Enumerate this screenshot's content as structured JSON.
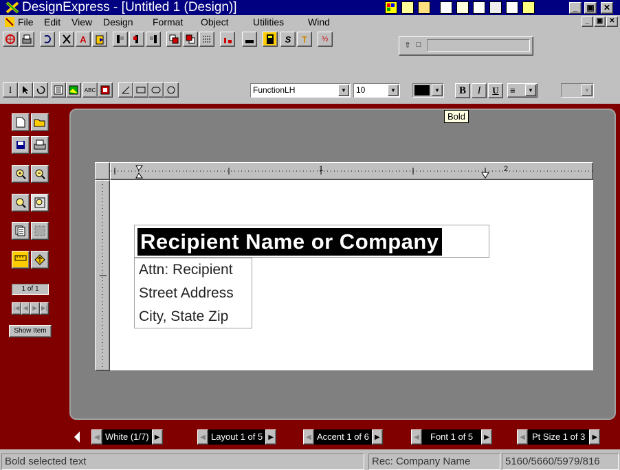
{
  "window": {
    "title": "DesignExpress - [Untitled 1 (Design)]"
  },
  "menu": {
    "items": [
      "File",
      "Edit",
      "View",
      "Design",
      "Format",
      "Object",
      "Utilities",
      "Wind"
    ]
  },
  "toolbar": {
    "font_name": "FunctionLH",
    "font_size": "10",
    "bold_label": "B",
    "italic_label": "I",
    "underline_label": "U"
  },
  "tooltip": {
    "text": "Bold"
  },
  "sidebar": {
    "page_counter": "1 of 1",
    "show_item_label": "Show Item"
  },
  "ruler": {
    "mark_1": "1",
    "mark_2": "2"
  },
  "document": {
    "recipient_name": "Recipient Name or Company",
    "attn": "Attn: Recipient",
    "street": "Street Address",
    "city": "City, State Zip"
  },
  "bottom_nav": {
    "color": "White (1/7)",
    "layout": "Layout 1 of 5",
    "accent": "Accent 1 of 6",
    "font": "Font 1 of 5",
    "pt_size": "Pt Size 1 of 3"
  },
  "status": {
    "message": "Bold selected text",
    "record": "Rec: Company Name",
    "label_codes": "5160/5660/5979/816"
  },
  "colors": {
    "title_bar": "#000080",
    "workspace": "#800000",
    "chrome": "#c0c0c0"
  }
}
